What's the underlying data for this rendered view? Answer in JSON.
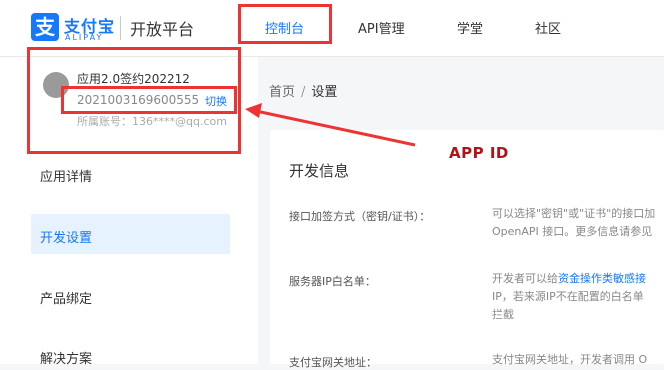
{
  "header": {
    "logo_glyph": "支",
    "logo_cn": "支付宝",
    "logo_en": "ALIPAY",
    "platform": "开放平台",
    "nav": [
      {
        "label": "控制台",
        "active": true
      },
      {
        "label": "API管理",
        "active": false
      },
      {
        "label": "学堂",
        "active": false
      },
      {
        "label": "社区",
        "active": false
      }
    ]
  },
  "sidebar": {
    "app_name": "应用2.0签约202212",
    "app_id": "2021003169600555",
    "switch_label": "切换",
    "owner_label": "所属账号：136****@qq.com",
    "menu": [
      {
        "label": "应用详情",
        "active": false
      },
      {
        "label": "开发设置",
        "active": true
      },
      {
        "label": "产品绑定",
        "active": false
      },
      {
        "label": "解决方案",
        "active": false
      }
    ]
  },
  "breadcrumb": {
    "home": "首页",
    "separator": "/",
    "current": "设置"
  },
  "annotation": {
    "label": "APP ID",
    "color": "#b3121b"
  },
  "main": {
    "section_title": "开发信息",
    "rows": [
      {
        "label": "接口加签方式（密钥/证书）：",
        "text_line1": "可以选择\"密钥\"或\"证书\"的接口加",
        "text_line2": "OpenAPI 接口。更多信息请参见"
      },
      {
        "label": "服务器IP白名单：",
        "text_line1_prefix": "开发者可以给",
        "text_line1_link": "资金操作类敏感接",
        "text_line2": "IP，若来源IP不在配置的白名单",
        "text_line3": "拦截"
      },
      {
        "label": "支付宝网关地址：",
        "text_line1": "支付宝网关地址，开发者调用 O"
      }
    ]
  },
  "colors": {
    "accent": "#1677ff",
    "highlight": "#ee3333"
  }
}
